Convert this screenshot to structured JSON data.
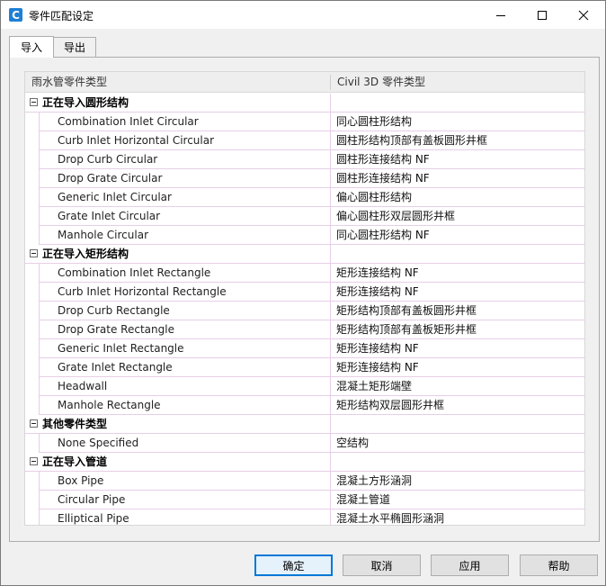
{
  "window": {
    "title": "零件匹配设定",
    "app_icon_letter": "C",
    "controls": [
      "minimize-icon",
      "maximize-icon",
      "close-icon"
    ]
  },
  "tabs": [
    {
      "label": "导入",
      "active": true
    },
    {
      "label": "导出",
      "active": false
    }
  ],
  "grid": {
    "columns": [
      "雨水管零件类型",
      "Civil 3D 零件类型"
    ],
    "groups": [
      {
        "title": "正在导入圆形结构",
        "rows": [
          {
            "name": "Combination Inlet Circular",
            "civil": "同心圆柱形结构"
          },
          {
            "name": "Curb Inlet Horizontal Circular",
            "civil": "圆柱形结构顶部有盖板圆形井框"
          },
          {
            "name": "Drop Curb Circular",
            "civil": "圆柱形连接结构 NF"
          },
          {
            "name": "Drop Grate Circular",
            "civil": "圆柱形连接结构 NF"
          },
          {
            "name": "Generic Inlet Circular",
            "civil": "偏心圆柱形结构"
          },
          {
            "name": "Grate Inlet Circular",
            "civil": "偏心圆柱形双层圆形井框"
          },
          {
            "name": "Manhole Circular",
            "civil": "同心圆柱形结构 NF"
          }
        ]
      },
      {
        "title": "正在导入矩形结构",
        "rows": [
          {
            "name": "Combination Inlet Rectangle",
            "civil": "矩形连接结构 NF"
          },
          {
            "name": "Curb Inlet Horizontal Rectangle",
            "civil": "矩形连接结构 NF"
          },
          {
            "name": "Drop Curb Rectangle",
            "civil": "矩形结构顶部有盖板圆形井框"
          },
          {
            "name": "Drop Grate Rectangle",
            "civil": "矩形结构顶部有盖板矩形井框"
          },
          {
            "name": "Generic Inlet Rectangle",
            "civil": "矩形连接结构 NF"
          },
          {
            "name": "Grate Inlet Rectangle",
            "civil": "矩形连接结构 NF"
          },
          {
            "name": "Headwall",
            "civil": "混凝土矩形端壁"
          },
          {
            "name": "Manhole Rectangle",
            "civil": "矩形结构双层圆形井框"
          }
        ]
      },
      {
        "title": "其他零件类型",
        "rows": [
          {
            "name": "None Specified",
            "civil": "空结构"
          }
        ]
      },
      {
        "title": "正在导入管道",
        "rows": [
          {
            "name": "Box Pipe",
            "civil": "混凝土方形涵洞"
          },
          {
            "name": "Circular Pipe",
            "civil": "混凝土管道"
          },
          {
            "name": "Elliptical Pipe",
            "civil": "混凝土水平椭圆形涵洞"
          }
        ]
      }
    ]
  },
  "buttons": {
    "ok": "确定",
    "cancel": "取消",
    "apply": "应用",
    "help": "帮助"
  }
}
